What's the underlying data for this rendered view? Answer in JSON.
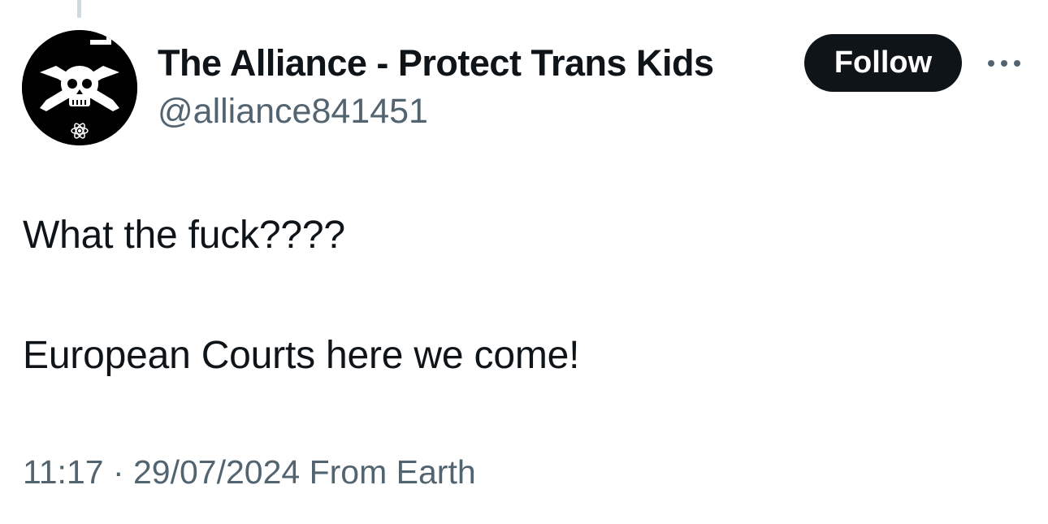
{
  "author": {
    "display_name": "The Alliance - Protect Trans Kids",
    "handle": "@alliance841451",
    "avatar_icon": "skull-crossbones-icon"
  },
  "actions": {
    "follow_label": "Follow",
    "more_icon": "more-options-icon"
  },
  "tweet": {
    "line1": "What the fuck????",
    "line2": "European Courts here we come!"
  },
  "meta": {
    "time": "11:17",
    "separator": " · ",
    "date": "29/07/2024",
    "source": " From Earth"
  },
  "colors": {
    "text_primary": "#0f1419",
    "text_secondary": "#536471",
    "follow_bg": "#0f1419",
    "thread_line": "#cfd9de"
  }
}
